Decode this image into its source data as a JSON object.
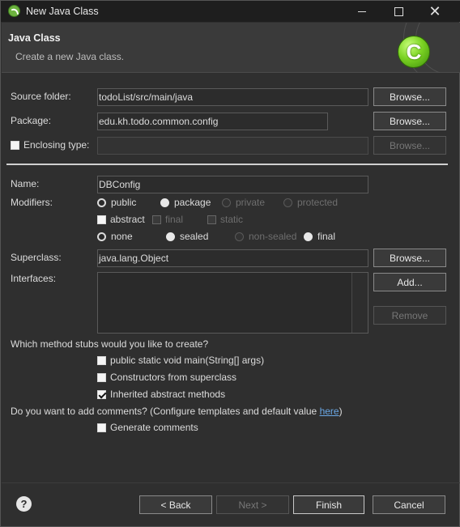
{
  "window": {
    "title": "New Java Class",
    "minimize": "minimize",
    "maximize": "maximize",
    "close": "✕"
  },
  "banner": {
    "title": "Java Class",
    "description": "Create a new Java class.",
    "badge_letter": "C"
  },
  "source_folder": {
    "label": "Source folder:",
    "value": "todoList/src/main/java",
    "browse": "Browse..."
  },
  "package": {
    "label": "Package:",
    "value": "edu.kh.todo.common.config",
    "browse": "Browse..."
  },
  "enclosing_type": {
    "label": "Enclosing type:",
    "value": "",
    "browse": "Browse..."
  },
  "name": {
    "label": "Name:",
    "value": "DBConfig"
  },
  "modifiers": {
    "label": "Modifiers:",
    "access": [
      {
        "label": "public",
        "selected": true,
        "enabled": true
      },
      {
        "label": "package",
        "selected": false,
        "enabled": true
      },
      {
        "label": "private",
        "selected": false,
        "enabled": false
      },
      {
        "label": "protected",
        "selected": false,
        "enabled": false
      }
    ],
    "flags": [
      {
        "label": "abstract",
        "checked": false,
        "enabled": true
      },
      {
        "label": "final",
        "checked": false,
        "enabled": false
      },
      {
        "label": "static",
        "checked": false,
        "enabled": false
      }
    ],
    "sealing": [
      {
        "label": "none",
        "selected": true,
        "enabled": true
      },
      {
        "label": "sealed",
        "selected": false,
        "enabled": true
      },
      {
        "label": "non-sealed",
        "selected": false,
        "enabled": false
      },
      {
        "label": "final",
        "selected": false,
        "enabled": true
      }
    ]
  },
  "superclass": {
    "label": "Superclass:",
    "value": "java.lang.Object",
    "browse": "Browse..."
  },
  "interfaces": {
    "label": "Interfaces:",
    "add": "Add...",
    "remove": "Remove"
  },
  "stubs": {
    "question": "Which method stubs would you like to create?",
    "items": [
      {
        "label": "public static void main(String[] args)",
        "checked": false
      },
      {
        "label": "Constructors from superclass",
        "checked": false
      },
      {
        "label": "Inherited abstract methods",
        "checked": true
      }
    ]
  },
  "comments": {
    "question": "Do you want to add comments? (Configure templates and default value ",
    "link": "here",
    "question_end": ")",
    "generate": {
      "label": "Generate comments",
      "checked": false
    }
  },
  "footer": {
    "help": "?",
    "back": "< Back",
    "next": "Next >",
    "finish": "Finish",
    "cancel": "Cancel"
  },
  "colors": {
    "background": "#2f2f2f",
    "titlebar": "#1e1e1e",
    "link": "#6aa8e6",
    "badge_green": "#7bd323"
  }
}
